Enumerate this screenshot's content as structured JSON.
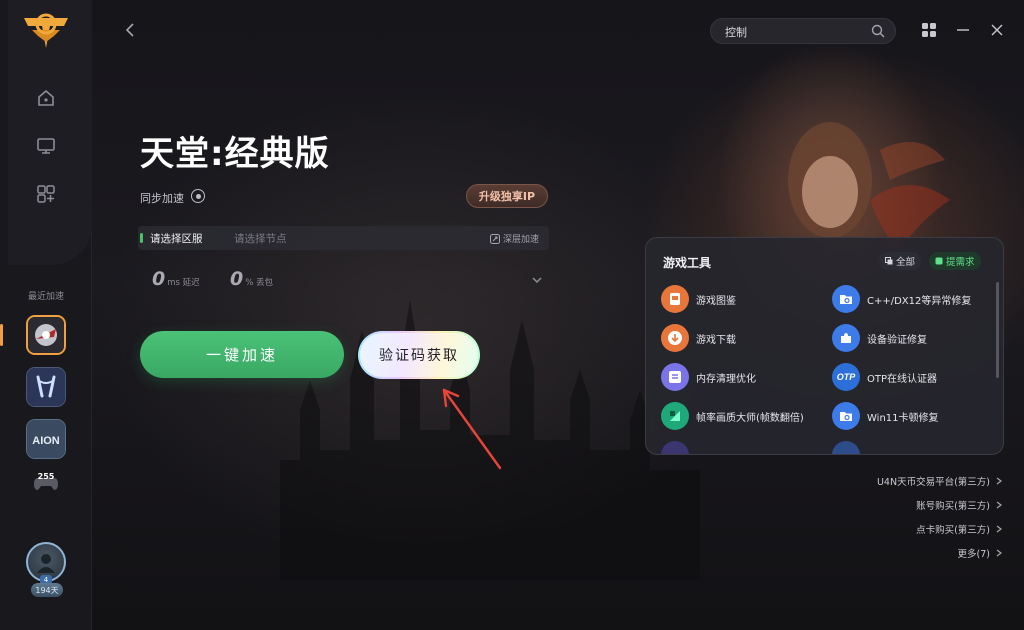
{
  "search": {
    "value": "控制"
  },
  "game": {
    "title": "天堂:经典版",
    "sync_label": "同步加速",
    "upgrade_ip_label": "升级独享IP",
    "region_label": "请选择区服",
    "node_placeholder": "请选择节点",
    "deep_accel_label": "深层加速",
    "latency_value": "0",
    "latency_unit": "ms 延迟",
    "loss_value": "0",
    "loss_unit": "% 丢包",
    "accelerate_label": "一键加速",
    "verify_label": "验证码获取"
  },
  "sidebar": {
    "recent_label": "最近加速",
    "badge_255": "255",
    "vip_days": "194天",
    "avatar_level": "4"
  },
  "tools": {
    "title": "游戏工具",
    "all_label": "全部",
    "request_label": "提需求",
    "items": [
      {
        "label": "游戏图鉴",
        "icon": "book-icon",
        "color": "#e8763a"
      },
      {
        "label": "C++/DX12等异常修复",
        "icon": "folder-search-icon",
        "color": "#3d7be8"
      },
      {
        "label": "游戏下载",
        "icon": "download-icon",
        "color": "#e8763a"
      },
      {
        "label": "设备验证修复",
        "icon": "puzzle-icon",
        "color": "#3d7be8"
      },
      {
        "label": "内存清理优化",
        "icon": "list-icon",
        "color": "#7a74e8"
      },
      {
        "label": "OTP在线认证器",
        "icon": "otp-icon",
        "color": "#2d6fd8"
      },
      {
        "label": "帧率画质大师(帧数翻倍)",
        "icon": "frame-icon",
        "color": "#1fa87a"
      },
      {
        "label": "Win11卡顿修复",
        "icon": "folder-search-icon",
        "color": "#3d7be8"
      }
    ]
  },
  "links": {
    "trade": "U4N天币交易平台(第三方)",
    "account": "账号购买(第三方)",
    "card": "点卡购买(第三方)",
    "more": "更多(7)"
  }
}
